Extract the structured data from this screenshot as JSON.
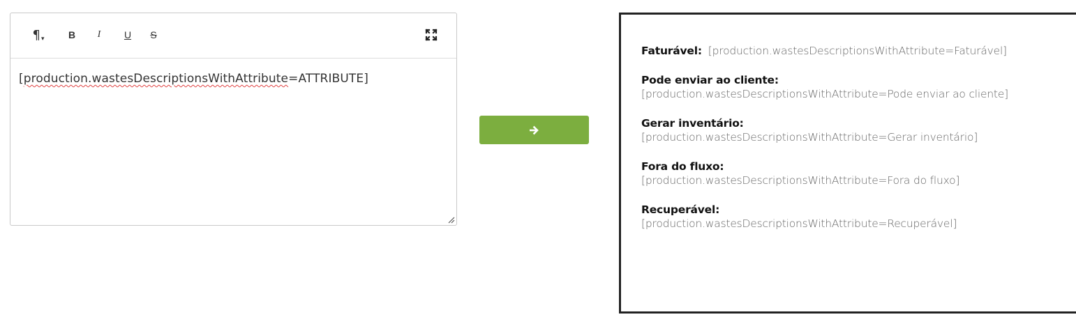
{
  "editor": {
    "content_part1": "[",
    "content_spell": "production.wastesDescriptionsWithAttribute",
    "content_part2": "=ATTRIBUTE]",
    "toolbar": {
      "paragraph_glyph": "¶",
      "bold_label": "B",
      "italic_label": "I",
      "underline_label": "U",
      "strike_label": "S"
    }
  },
  "convert_button": {
    "icon": "arrow-right-icon",
    "color": "#7cae3f"
  },
  "preview": {
    "entries": [
      {
        "label": "Faturável:",
        "value": "[production.wastesDescriptionsWithAttribute=Faturável]"
      },
      {
        "label": "Pode enviar ao cliente:",
        "value": "[production.wastesDescriptionsWithAttribute=Pode enviar ao cliente]"
      },
      {
        "label": "Gerar inventário:",
        "value": "[production.wastesDescriptionsWithAttribute=Gerar inventário]"
      },
      {
        "label": "Fora do fluxo:",
        "value": "[production.wastesDescriptionsWithAttribute=Fora do fluxo]"
      },
      {
        "label": "Recuperável:",
        "value": "[production.wastesDescriptionsWithAttribute=Recuperável]"
      }
    ]
  }
}
